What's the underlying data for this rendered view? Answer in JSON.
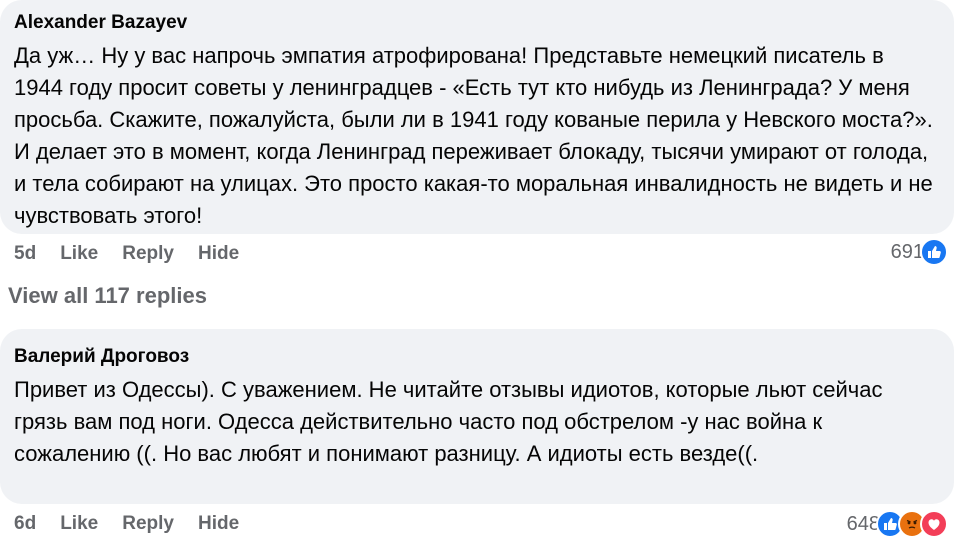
{
  "comments": [
    {
      "author": "Alexander Bazayev",
      "text": "Да уж… Ну у вас напрочь эмпатия атрофирована! Представьте немецкий писатель в 1944 году просит советы у ленинградцев - «Есть тут кто нибудь из Ленинграда? У меня просьба. Скажите, пожалуйста, были ли в 1941 году кованые перила у Невского моста?». И делает это в момент, когда Ленинград переживает блокаду, тысячи умирают от голода, и тела собирают на улицах. Это просто какая-то моральная инвалидность не видеть и не чувствовать этого!",
      "time": "5d",
      "like_label": "Like",
      "reply_label": "Reply",
      "hide_label": "Hide",
      "reaction_count": "691",
      "reactions": [
        "like-icon"
      ]
    },
    {
      "author": "Валерий Дроговоз",
      "text": "Привет из Одессы). С уважением. Не читайте отзывы идиотов, которые льют сейчас грязь вам под ноги. Одесса действительно часто под обстрелом -у нас война к сожалению ((. Но вас любят и понимают разницу. А идиоты есть везде((.",
      "time": "6d",
      "like_label": "Like",
      "reply_label": "Reply",
      "hide_label": "Hide",
      "reaction_count": "648",
      "reactions": [
        "like-icon",
        "angry-icon",
        "love-icon"
      ]
    }
  ],
  "view_replies_label": "View all 117 replies",
  "colors": {
    "bubble": "#f0f2f5",
    "secondary_text": "#65676b",
    "like_blue": "#1877f2",
    "angry_orange": "#e9710f",
    "love_red": "#f33e58"
  }
}
